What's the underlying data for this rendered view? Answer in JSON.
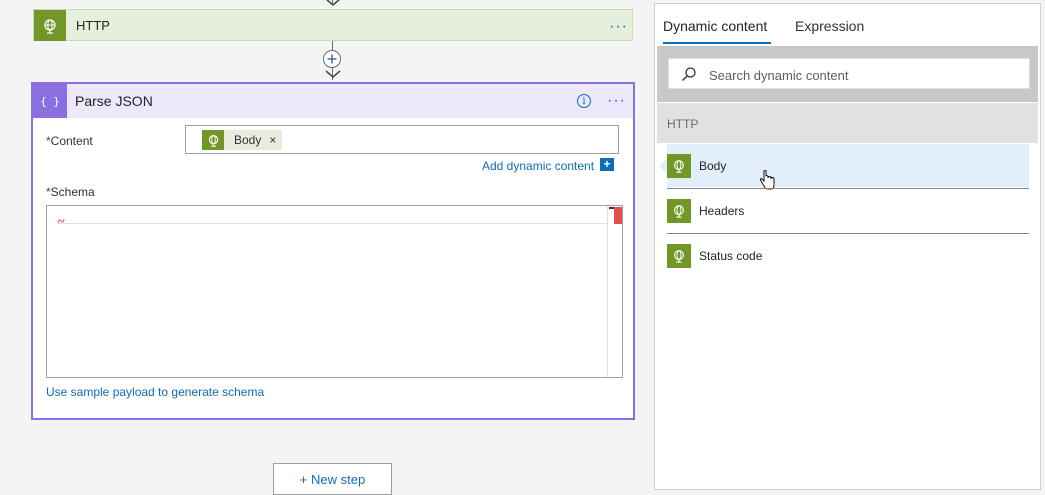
{
  "http_action": {
    "title": "HTTP",
    "more": "···"
  },
  "parse_json": {
    "title": "Parse JSON",
    "more": "···",
    "info": "i",
    "content_label": "Content",
    "content_token": "Body",
    "token_remove": "×",
    "add_dynamic_content": "Add dynamic content",
    "add_dynamic_plus": "+",
    "schema_label": "Schema",
    "sample_payload_link": "Use sample payload to generate schema",
    "required_mark": "*"
  },
  "new_step": {
    "label": "+ New step"
  },
  "panel": {
    "tabs": [
      {
        "label": "Dynamic content",
        "active": true
      },
      {
        "label": "Expression",
        "active": false
      }
    ],
    "search_placeholder": "Search dynamic content",
    "section": "HTTP",
    "items": [
      {
        "label": "Body",
        "selected": true
      },
      {
        "label": "Headers",
        "selected": false
      },
      {
        "label": "Status code",
        "selected": false
      }
    ]
  },
  "colors": {
    "http_accent": "#709727",
    "parse_json_accent": "#8a6fe0",
    "link": "#0f6cbd",
    "selected_item": "#e3eefb"
  }
}
